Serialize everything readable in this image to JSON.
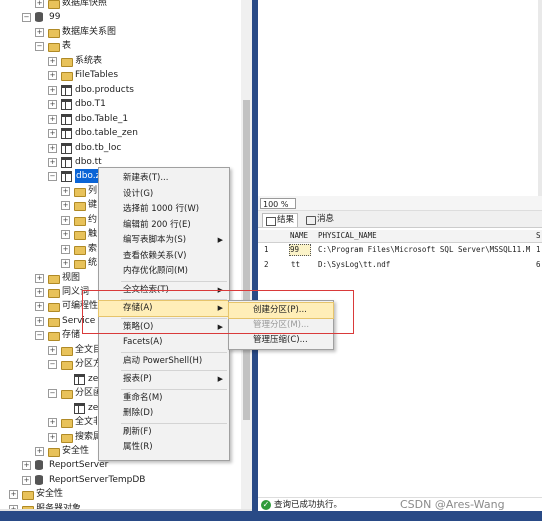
{
  "explorer": {
    "nodes": [
      {
        "label": "数据库快照",
        "indent": 1,
        "exp": "+",
        "icon": "folder"
      },
      {
        "label": "99",
        "indent": 0,
        "exp": "-",
        "icon": "db"
      },
      {
        "label": "数据库关系图",
        "indent": 1,
        "exp": "+",
        "icon": "folder"
      },
      {
        "label": "表",
        "indent": 1,
        "exp": "-",
        "icon": "folder"
      },
      {
        "label": "系统表",
        "indent": 2,
        "exp": "+",
        "icon": "folder"
      },
      {
        "label": "FileTables",
        "indent": 2,
        "exp": "+",
        "icon": "folder"
      },
      {
        "label": "dbo.products",
        "indent": 2,
        "exp": "+",
        "icon": "table"
      },
      {
        "label": "dbo.T1",
        "indent": 2,
        "exp": "+",
        "icon": "table"
      },
      {
        "label": "dbo.Table_1",
        "indent": 2,
        "exp": "+",
        "icon": "table"
      },
      {
        "label": "dbo.table_zen",
        "indent": 2,
        "exp": "+",
        "icon": "table"
      },
      {
        "label": "dbo.tb_loc",
        "indent": 2,
        "exp": "+",
        "icon": "table"
      },
      {
        "label": "dbo.tt",
        "indent": 2,
        "exp": "+",
        "icon": "table"
      },
      {
        "label": "dbo.z",
        "indent": 2,
        "exp": "-",
        "icon": "table",
        "selected": true
      },
      {
        "label": "列",
        "indent": 3,
        "exp": "+",
        "icon": "folder"
      },
      {
        "label": "键",
        "indent": 3,
        "exp": "+",
        "icon": "folder"
      },
      {
        "label": "约",
        "indent": 3,
        "exp": "+",
        "icon": "folder"
      },
      {
        "label": "触",
        "indent": 3,
        "exp": "+",
        "icon": "folder"
      },
      {
        "label": "索",
        "indent": 3,
        "exp": "+",
        "icon": "folder"
      },
      {
        "label": "统",
        "indent": 3,
        "exp": "+",
        "icon": "folder"
      },
      {
        "label": "视图",
        "indent": 1,
        "exp": "+",
        "icon": "folder"
      },
      {
        "label": "同义词",
        "indent": 1,
        "exp": "+",
        "icon": "folder"
      },
      {
        "label": "可编程性",
        "indent": 1,
        "exp": "+",
        "icon": "folder"
      },
      {
        "label": "Service B",
        "indent": 1,
        "exp": "+",
        "icon": "folder"
      },
      {
        "label": "存储",
        "indent": 1,
        "exp": "-",
        "icon": "folder"
      },
      {
        "label": "全文目",
        "indent": 2,
        "exp": "+",
        "icon": "folder"
      },
      {
        "label": "分区方",
        "indent": 2,
        "exp": "-",
        "icon": "folder"
      },
      {
        "label": "ze",
        "indent": 3,
        "exp": "",
        "icon": "table"
      },
      {
        "label": "分区函",
        "indent": 2,
        "exp": "-",
        "icon": "folder"
      },
      {
        "label": "ze",
        "indent": 3,
        "exp": "",
        "icon": "table"
      },
      {
        "label": "全文非",
        "indent": 2,
        "exp": "+",
        "icon": "folder"
      },
      {
        "label": "搜索属",
        "indent": 2,
        "exp": "+",
        "icon": "folder"
      },
      {
        "label": "安全性",
        "indent": 1,
        "exp": "+",
        "icon": "folder"
      },
      {
        "label": "ReportServer",
        "indent": 0,
        "exp": "+",
        "icon": "db"
      },
      {
        "label": "ReportServerTempDB",
        "indent": 0,
        "exp": "+",
        "icon": "db"
      },
      {
        "label": "安全性",
        "indent": -1,
        "exp": "+",
        "icon": "folder"
      },
      {
        "label": "服务器对象",
        "indent": -1,
        "exp": "+",
        "icon": "folder"
      }
    ]
  },
  "zoom": "100 %",
  "tabs": {
    "results": "结果",
    "messages": "消息"
  },
  "grid": {
    "columns": [
      "NAME",
      "PHYSICAL_NAME",
      "S"
    ],
    "rows": [
      {
        "num": "1",
        "name": "99",
        "path": "C:\\Program Files\\Microsoft SQL Server\\MSSQL11.M...",
        "s": "1"
      },
      {
        "num": "2",
        "name": "tt",
        "path": "D:\\SysLog\\tt.ndf",
        "s": "6"
      }
    ]
  },
  "status": "查询已成功执行。",
  "watermark": "CSDN @Ares-Wang",
  "context_menu": {
    "items": [
      {
        "label": "新建表(T)...",
        "sub": false
      },
      {
        "label": "设计(G)",
        "sub": false
      },
      {
        "label": "选择前 1000 行(W)",
        "sub": false
      },
      {
        "label": "编辑前 200 行(E)",
        "sub": false
      },
      {
        "label": "编写表脚本为(S)",
        "sub": true
      },
      {
        "label": "查看依赖关系(V)",
        "sub": false
      },
      {
        "label": "内存优化顾问(M)",
        "sub": false
      },
      {
        "label": "sep"
      },
      {
        "label": "全文检索(T)",
        "sub": true
      },
      {
        "label": "sep"
      },
      {
        "label": "存储(A)",
        "sub": true,
        "highlight": true
      },
      {
        "label": "sep"
      },
      {
        "label": "策略(O)",
        "sub": true
      },
      {
        "label": "Facets(A)",
        "sub": false
      },
      {
        "label": "sep"
      },
      {
        "label": "启动 PowerShell(H)",
        "sub": false
      },
      {
        "label": "sep"
      },
      {
        "label": "报表(P)",
        "sub": true
      },
      {
        "label": "sep"
      },
      {
        "label": "重命名(M)",
        "sub": false
      },
      {
        "label": "删除(D)",
        "sub": false
      },
      {
        "label": "sep"
      },
      {
        "label": "刷新(F)",
        "sub": false
      },
      {
        "label": "属性(R)",
        "sub": false
      }
    ]
  },
  "submenu": {
    "items": [
      {
        "label": "创建分区(P)...",
        "highlight": true
      },
      {
        "label": "管理分区(M)...",
        "disabled": true
      },
      {
        "label": "管理压缩(C)..."
      }
    ]
  }
}
